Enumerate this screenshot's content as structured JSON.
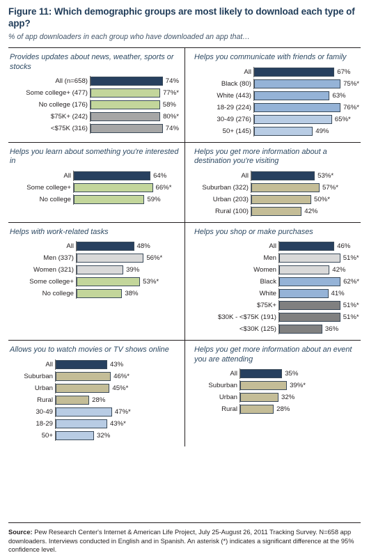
{
  "header": {
    "title": "Figure 11: Which demographic groups are most likely to download each type of app?",
    "subtitle": "% of app downloaders in each group who have downloaded an app that…"
  },
  "colors": {
    "navy": "#27405f",
    "green": "#c3d69b",
    "gray_light": "#d9d9d9",
    "gray_mid": "#a6a6a6",
    "gray_dark": "#808080",
    "blue_mid": "#95b3d7",
    "blue_light": "#b8cce4",
    "tan": "#c4bd97",
    "text": "#231f20",
    "title": "#1f3b58"
  },
  "footer": {
    "source_label": "Source:",
    "source_text": "Pew Research Center's Internet & American Life Project, July 25-August 26, 2011 Tracking Survey.  N=658 app downloaders. Interviews conducted in English and in Spanish. An asterisk (*) indicates a significant difference at the 95% confidence level."
  },
  "chart_data": [
    {
      "type": "bar",
      "id": "panel-news-weather-sports-stocks",
      "title": "Provides updates about news, weather, sports or stocks",
      "orientation": "horizontal",
      "xlim": [
        0,
        100
      ],
      "xlabel": "",
      "ylabel": "",
      "grid": false,
      "categories": [
        "All (n=658)",
        "Some college+ (477)",
        "No college (176)",
        "$75K+ (242)",
        "<$75K (316)"
      ],
      "values": [
        74,
        77,
        58,
        80,
        74
      ],
      "labels": [
        "74%",
        "77%*",
        "58%",
        "80%*",
        "74%"
      ],
      "bar_colors": [
        "navy",
        "green",
        "green",
        "gray_mid",
        "gray_mid"
      ]
    },
    {
      "type": "bar",
      "id": "panel-communicate-friends-family",
      "title": "Helps you communicate with friends or family",
      "orientation": "horizontal",
      "xlim": [
        0,
        100
      ],
      "xlabel": "",
      "ylabel": "",
      "grid": false,
      "categories": [
        "All",
        "Black (80)",
        "White (443)",
        "18-29 (224)",
        "30-49 (276)",
        "50+ (145)"
      ],
      "values": [
        67,
        75,
        63,
        76,
        65,
        49
      ],
      "labels": [
        "67%",
        "75%*",
        "63%",
        "76%*",
        "65%*",
        "49%"
      ],
      "bar_colors": [
        "navy",
        "blue_mid",
        "blue_mid",
        "blue_mid",
        "blue_light",
        "blue_light"
      ]
    },
    {
      "type": "bar",
      "id": "panel-learn-about-something",
      "title": "Helps you learn about something you're interested in",
      "orientation": "horizontal",
      "xlim": [
        0,
        100
      ],
      "xlabel": "",
      "ylabel": "",
      "grid": false,
      "categories": [
        "All",
        "Some college+",
        "No college"
      ],
      "values": [
        64,
        66,
        59
      ],
      "labels": [
        "64%",
        "66%*",
        "59%"
      ],
      "bar_colors": [
        "navy",
        "green",
        "green"
      ]
    },
    {
      "type": "bar",
      "id": "panel-destination-information",
      "title": "Helps you get more information about a destination you're visiting",
      "orientation": "horizontal",
      "xlim": [
        0,
        100
      ],
      "xlabel": "",
      "ylabel": "",
      "grid": false,
      "categories": [
        "All",
        "Suburban (322)",
        "Urban (203)",
        "Rural (100)"
      ],
      "values": [
        53,
        57,
        50,
        42
      ],
      "labels": [
        "53%*",
        "57%*",
        "50%*",
        "42%"
      ],
      "bar_colors": [
        "navy",
        "tan",
        "tan",
        "tan"
      ]
    },
    {
      "type": "bar",
      "id": "panel-work-related-tasks",
      "title": "Helps with work-related tasks",
      "orientation": "horizontal",
      "xlim": [
        0,
        100
      ],
      "xlabel": "",
      "ylabel": "",
      "grid": false,
      "categories": [
        "All",
        "Men (337)",
        "Women (321)",
        "Some college+",
        "No college"
      ],
      "values": [
        48,
        56,
        39,
        53,
        38
      ],
      "labels": [
        "48%",
        "56%*",
        "39%",
        "53%*",
        "38%"
      ],
      "bar_colors": [
        "navy",
        "gray_light",
        "gray_light",
        "green",
        "green"
      ]
    },
    {
      "type": "bar",
      "id": "panel-shop-make-purchases",
      "title": "Helps you shop or make purchases",
      "orientation": "horizontal",
      "xlim": [
        0,
        100
      ],
      "xlabel": "",
      "ylabel": "",
      "grid": false,
      "categories": [
        "All",
        "Men",
        "Women",
        "Black",
        "White",
        "$75K+",
        "$30K - <$75K (191)",
        "<$30K (125)"
      ],
      "values": [
        46,
        51,
        42,
        62,
        41,
        51,
        51,
        36
      ],
      "labels": [
        "46%",
        "51%*",
        "42%",
        "62%*",
        "41%",
        "51%*",
        "51%*",
        "36%"
      ],
      "bar_colors": [
        "navy",
        "gray_light",
        "gray_light",
        "blue_mid",
        "blue_mid",
        "gray_dark",
        "gray_dark",
        "gray_dark"
      ]
    },
    {
      "type": "bar",
      "id": "panel-watch-movies-tv",
      "title": "Allows you to watch movies or TV shows online",
      "orientation": "horizontal",
      "xlim": [
        0,
        100
      ],
      "xlabel": "",
      "ylabel": "",
      "grid": false,
      "categories": [
        "All",
        "Suburban",
        "Urban",
        "Rural",
        "30-49",
        "18-29",
        "50+"
      ],
      "values": [
        43,
        46,
        45,
        28,
        47,
        43,
        32
      ],
      "labels": [
        "43%",
        "46%*",
        "45%*",
        "28%",
        "47%*",
        "43%*",
        "32%"
      ],
      "bar_colors": [
        "navy",
        "tan",
        "tan",
        "tan",
        "blue_light",
        "blue_light",
        "blue_light"
      ]
    },
    {
      "type": "bar",
      "id": "panel-event-information",
      "title": "Helps you get more information about an event you are attending",
      "orientation": "horizontal",
      "xlim": [
        0,
        100
      ],
      "xlabel": "",
      "ylabel": "",
      "grid": false,
      "categories": [
        "All",
        "Suburban",
        "Urban",
        "Rural"
      ],
      "values": [
        35,
        39,
        32,
        28
      ],
      "labels": [
        "35%",
        "39%*",
        "32%",
        "28%"
      ],
      "bar_colors": [
        "navy",
        "tan",
        "tan",
        "tan"
      ]
    }
  ]
}
